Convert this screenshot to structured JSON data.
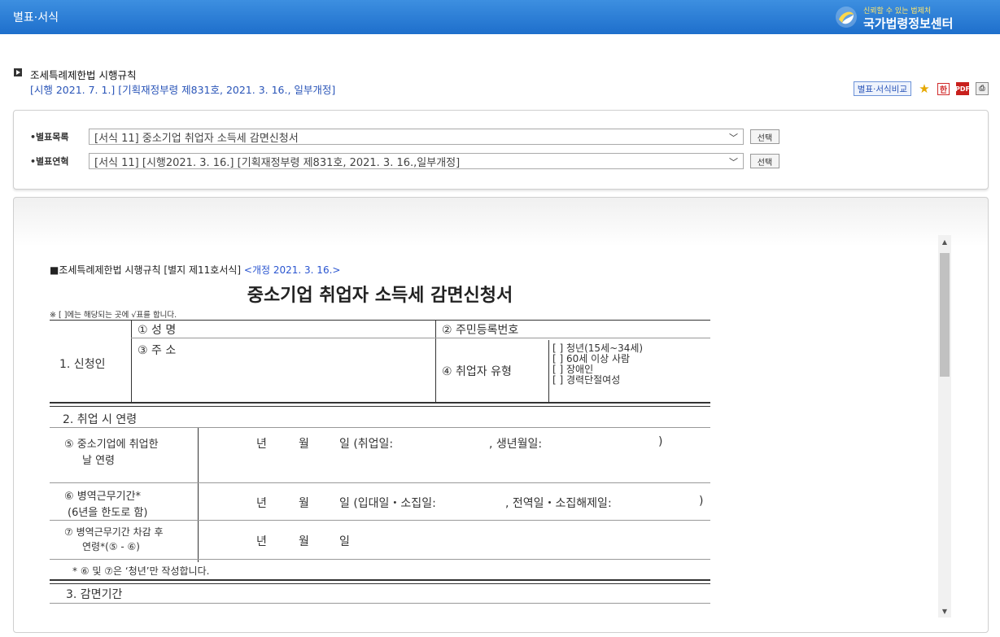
{
  "header": {
    "title": "별표·서식",
    "brand_tagline": "신뢰할 수 있는 법제처",
    "brand_name": "국가법령정보센터"
  },
  "law": {
    "name": "조세특례제한법 시행규칙",
    "meta": "[시행 2021. 7. 1.] [기획재정부령 제831호, 2021. 3. 16., 일부개정]",
    "compare_label": "별표·서식비교",
    "tool_icons": [
      "star-icon",
      "hwp-icon",
      "pdf-icon",
      "print-icon"
    ]
  },
  "selector": {
    "list_label": "•별표목록",
    "list_value": "[서식 11] 중소기업 취업자 소득세 감면신청서",
    "list_button": "선택",
    "history_label": "•별표연혁",
    "history_value": "[서식 11] [시행2021. 3. 16.] [기획재정부령 제831호, 2021. 3. 16.,일부개정]",
    "history_button": "선택"
  },
  "document": {
    "header_prefix": "■조세특례제한법 시행규칙 [별지 제11호서식] ",
    "header_revision": "<개정 2021. 3. 16.>",
    "title": "중소기업 취업자 소득세 감면신청서",
    "note": "※ [ ]에는 해당되는 곳에 √표를 합니다.",
    "section1": {
      "label": "1. 신청인",
      "name": "① 성 명",
      "rrn": "② 주민등록번호",
      "address": "③ 주 소",
      "type": "④ 취업자 유형",
      "options": [
        "[ ] 청년(15세~34세)",
        "[ ] 60세 이상 사람",
        "[ ] 장애인",
        "[ ] 경력단절여성"
      ]
    },
    "section2": {
      "label": "2. 취업 시 연령",
      "row5_l1": "⑤ 중소기업에 취업한",
      "row5_l2": "날 연령",
      "row5_year": "년",
      "row5_month": "월",
      "row5_day": "일 (취업일:",
      "row5_birth": ", 생년월일:",
      "row5_close": ")",
      "row6_l1": "⑥ 병역근무기간*",
      "row6_l2": "(6년을 한도로 함)",
      "row6_year": "년",
      "row6_month": "월",
      "row6_day": "일 (입대일・소집일:",
      "row6_disch": ", 전역일・소집해제일:",
      "row6_close": ")",
      "row7_l1": "⑦ 병역근무기간 차감 후",
      "row7_l2": "연령*(⑤ - ⑥)",
      "row7_year": "년",
      "row7_month": "월",
      "row7_day": "일",
      "footnote": "* ⑥ 및 ⑦은 ‘청년’만 작성합니다."
    },
    "section3": {
      "label": "3. 감면기간"
    }
  }
}
